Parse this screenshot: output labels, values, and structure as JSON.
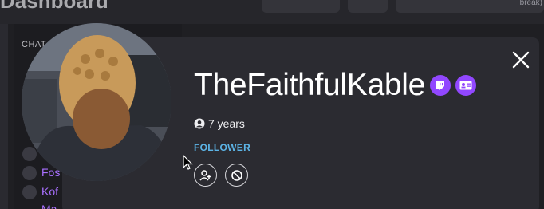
{
  "background": {
    "dashboard_title": "Dashboard",
    "corner_text": "break)",
    "chat_label": "CHAT",
    "chat_users": [
      "Fos",
      "Kof",
      "Ma"
    ]
  },
  "profile": {
    "username": "TheFaithfulKable",
    "account_age": "7 years",
    "role": "FOLLOWER",
    "badges": [
      "twitch-icon",
      "subscriber-card-icon"
    ]
  },
  "icons": {
    "close": "close-icon",
    "user": "user-circle-icon",
    "add_friend": "add-user-icon",
    "block": "block-icon",
    "cursor": "mouse-pointer-icon"
  },
  "colors": {
    "card_bg": "#2b2b31",
    "badge": "#9147ff",
    "role": "#5cb4e6",
    "username": "#ffffff"
  }
}
